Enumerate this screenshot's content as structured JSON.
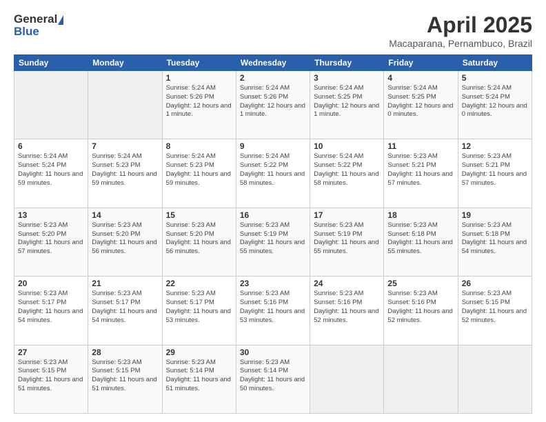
{
  "logo": {
    "general": "General",
    "blue": "Blue"
  },
  "title": "April 2025",
  "subtitle": "Macaparana, Pernambuco, Brazil",
  "days_of_week": [
    "Sunday",
    "Monday",
    "Tuesday",
    "Wednesday",
    "Thursday",
    "Friday",
    "Saturday"
  ],
  "weeks": [
    [
      {
        "day": "",
        "info": ""
      },
      {
        "day": "",
        "info": ""
      },
      {
        "day": "1",
        "sunrise": "Sunrise: 5:24 AM",
        "sunset": "Sunset: 5:26 PM",
        "daylight": "Daylight: 12 hours and 1 minute."
      },
      {
        "day": "2",
        "sunrise": "Sunrise: 5:24 AM",
        "sunset": "Sunset: 5:26 PM",
        "daylight": "Daylight: 12 hours and 1 minute."
      },
      {
        "day": "3",
        "sunrise": "Sunrise: 5:24 AM",
        "sunset": "Sunset: 5:25 PM",
        "daylight": "Daylight: 12 hours and 1 minute."
      },
      {
        "day": "4",
        "sunrise": "Sunrise: 5:24 AM",
        "sunset": "Sunset: 5:25 PM",
        "daylight": "Daylight: 12 hours and 0 minutes."
      },
      {
        "day": "5",
        "sunrise": "Sunrise: 5:24 AM",
        "sunset": "Sunset: 5:24 PM",
        "daylight": "Daylight: 12 hours and 0 minutes."
      }
    ],
    [
      {
        "day": "6",
        "sunrise": "Sunrise: 5:24 AM",
        "sunset": "Sunset: 5:24 PM",
        "daylight": "Daylight: 11 hours and 59 minutes."
      },
      {
        "day": "7",
        "sunrise": "Sunrise: 5:24 AM",
        "sunset": "Sunset: 5:23 PM",
        "daylight": "Daylight: 11 hours and 59 minutes."
      },
      {
        "day": "8",
        "sunrise": "Sunrise: 5:24 AM",
        "sunset": "Sunset: 5:23 PM",
        "daylight": "Daylight: 11 hours and 59 minutes."
      },
      {
        "day": "9",
        "sunrise": "Sunrise: 5:24 AM",
        "sunset": "Sunset: 5:22 PM",
        "daylight": "Daylight: 11 hours and 58 minutes."
      },
      {
        "day": "10",
        "sunrise": "Sunrise: 5:24 AM",
        "sunset": "Sunset: 5:22 PM",
        "daylight": "Daylight: 11 hours and 58 minutes."
      },
      {
        "day": "11",
        "sunrise": "Sunrise: 5:23 AM",
        "sunset": "Sunset: 5:21 PM",
        "daylight": "Daylight: 11 hours and 57 minutes."
      },
      {
        "day": "12",
        "sunrise": "Sunrise: 5:23 AM",
        "sunset": "Sunset: 5:21 PM",
        "daylight": "Daylight: 11 hours and 57 minutes."
      }
    ],
    [
      {
        "day": "13",
        "sunrise": "Sunrise: 5:23 AM",
        "sunset": "Sunset: 5:20 PM",
        "daylight": "Daylight: 11 hours and 57 minutes."
      },
      {
        "day": "14",
        "sunrise": "Sunrise: 5:23 AM",
        "sunset": "Sunset: 5:20 PM",
        "daylight": "Daylight: 11 hours and 56 minutes."
      },
      {
        "day": "15",
        "sunrise": "Sunrise: 5:23 AM",
        "sunset": "Sunset: 5:20 PM",
        "daylight": "Daylight: 11 hours and 56 minutes."
      },
      {
        "day": "16",
        "sunrise": "Sunrise: 5:23 AM",
        "sunset": "Sunset: 5:19 PM",
        "daylight": "Daylight: 11 hours and 55 minutes."
      },
      {
        "day": "17",
        "sunrise": "Sunrise: 5:23 AM",
        "sunset": "Sunset: 5:19 PM",
        "daylight": "Daylight: 11 hours and 55 minutes."
      },
      {
        "day": "18",
        "sunrise": "Sunrise: 5:23 AM",
        "sunset": "Sunset: 5:18 PM",
        "daylight": "Daylight: 11 hours and 55 minutes."
      },
      {
        "day": "19",
        "sunrise": "Sunrise: 5:23 AM",
        "sunset": "Sunset: 5:18 PM",
        "daylight": "Daylight: 11 hours and 54 minutes."
      }
    ],
    [
      {
        "day": "20",
        "sunrise": "Sunrise: 5:23 AM",
        "sunset": "Sunset: 5:17 PM",
        "daylight": "Daylight: 11 hours and 54 minutes."
      },
      {
        "day": "21",
        "sunrise": "Sunrise: 5:23 AM",
        "sunset": "Sunset: 5:17 PM",
        "daylight": "Daylight: 11 hours and 54 minutes."
      },
      {
        "day": "22",
        "sunrise": "Sunrise: 5:23 AM",
        "sunset": "Sunset: 5:17 PM",
        "daylight": "Daylight: 11 hours and 53 minutes."
      },
      {
        "day": "23",
        "sunrise": "Sunrise: 5:23 AM",
        "sunset": "Sunset: 5:16 PM",
        "daylight": "Daylight: 11 hours and 53 minutes."
      },
      {
        "day": "24",
        "sunrise": "Sunrise: 5:23 AM",
        "sunset": "Sunset: 5:16 PM",
        "daylight": "Daylight: 11 hours and 52 minutes."
      },
      {
        "day": "25",
        "sunrise": "Sunrise: 5:23 AM",
        "sunset": "Sunset: 5:16 PM",
        "daylight": "Daylight: 11 hours and 52 minutes."
      },
      {
        "day": "26",
        "sunrise": "Sunrise: 5:23 AM",
        "sunset": "Sunset: 5:15 PM",
        "daylight": "Daylight: 11 hours and 52 minutes."
      }
    ],
    [
      {
        "day": "27",
        "sunrise": "Sunrise: 5:23 AM",
        "sunset": "Sunset: 5:15 PM",
        "daylight": "Daylight: 11 hours and 51 minutes."
      },
      {
        "day": "28",
        "sunrise": "Sunrise: 5:23 AM",
        "sunset": "Sunset: 5:15 PM",
        "daylight": "Daylight: 11 hours and 51 minutes."
      },
      {
        "day": "29",
        "sunrise": "Sunrise: 5:23 AM",
        "sunset": "Sunset: 5:14 PM",
        "daylight": "Daylight: 11 hours and 51 minutes."
      },
      {
        "day": "30",
        "sunrise": "Sunrise: 5:23 AM",
        "sunset": "Sunset: 5:14 PM",
        "daylight": "Daylight: 11 hours and 50 minutes."
      },
      {
        "day": "",
        "info": ""
      },
      {
        "day": "",
        "info": ""
      },
      {
        "day": "",
        "info": ""
      }
    ]
  ]
}
